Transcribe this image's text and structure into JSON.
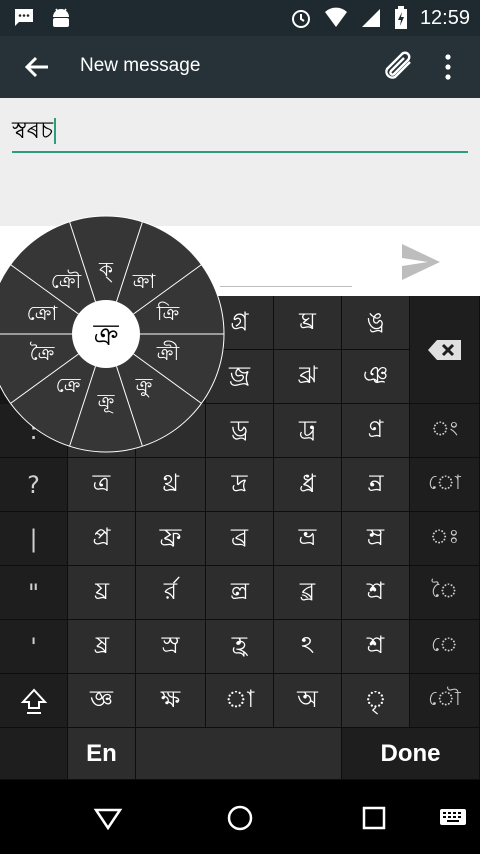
{
  "status_bar": {
    "time": "12:59",
    "left_icons": [
      "message-icon",
      "android-icon"
    ],
    "right_icons": [
      "alarm-icon",
      "wifi-icon",
      "signal-icon",
      "battery-icon"
    ]
  },
  "app_bar": {
    "title": "New message",
    "icons": [
      "back-arrow-icon",
      "attach-icon",
      "more-vert-icon"
    ]
  },
  "compose": {
    "recipient_value": "স্বৰচ",
    "accent_color": "#2e9d7e"
  },
  "keyboard": {
    "main_grid": [
      [
        "",
        "",
        "",
        "গ্র",
        "ঘ্র",
        "ঙ্র"
      ],
      [
        "",
        "",
        "",
        "জ্র",
        "ঝ্র",
        "ঞ্র"
      ],
      [
        "",
        "",
        "",
        "ড্র",
        "ঢ্র",
        "ণ্র"
      ],
      [
        "ত্র",
        "থ্র",
        "দ্র",
        "ধ্র",
        "ন্র"
      ],
      [
        "প্র",
        "ফ্র",
        "ব্র",
        "ভ্র",
        "ম্র"
      ],
      [
        "য্র",
        "ৰ্র",
        "ল্র",
        "ৱ্র",
        "শ্র"
      ],
      [
        "ষ্র",
        "স্র",
        "হ্র",
        "ঽ",
        "শ্র"
      ],
      [
        "জ্ঞ",
        "ক্ষ",
        "া",
        "অ",
        "ৃ"
      ]
    ],
    "left_column": [
      ":",
      "?",
      "|",
      "\"",
      "'"
    ],
    "right_column": [
      "ং",
      "ো",
      "ঃ",
      "ৈ",
      "ে",
      "ৌ"
    ],
    "row4_symbols": {
      "tha": "থ্র",
      "da": "দ্র",
      "dha": "ধ্র",
      "na": "ন্র",
      "ta": "ত্র"
    },
    "en_label": "En",
    "done_label": "Done"
  },
  "radial_popup": {
    "center": "ক্র",
    "items": [
      "ক্",
      "ক্রা",
      "ক্রি",
      "ক্রী",
      "ক্রু",
      "ক্রূ",
      "ক্রে",
      "ক্রৈ",
      "ক্রো",
      "ক্রৌ"
    ]
  }
}
